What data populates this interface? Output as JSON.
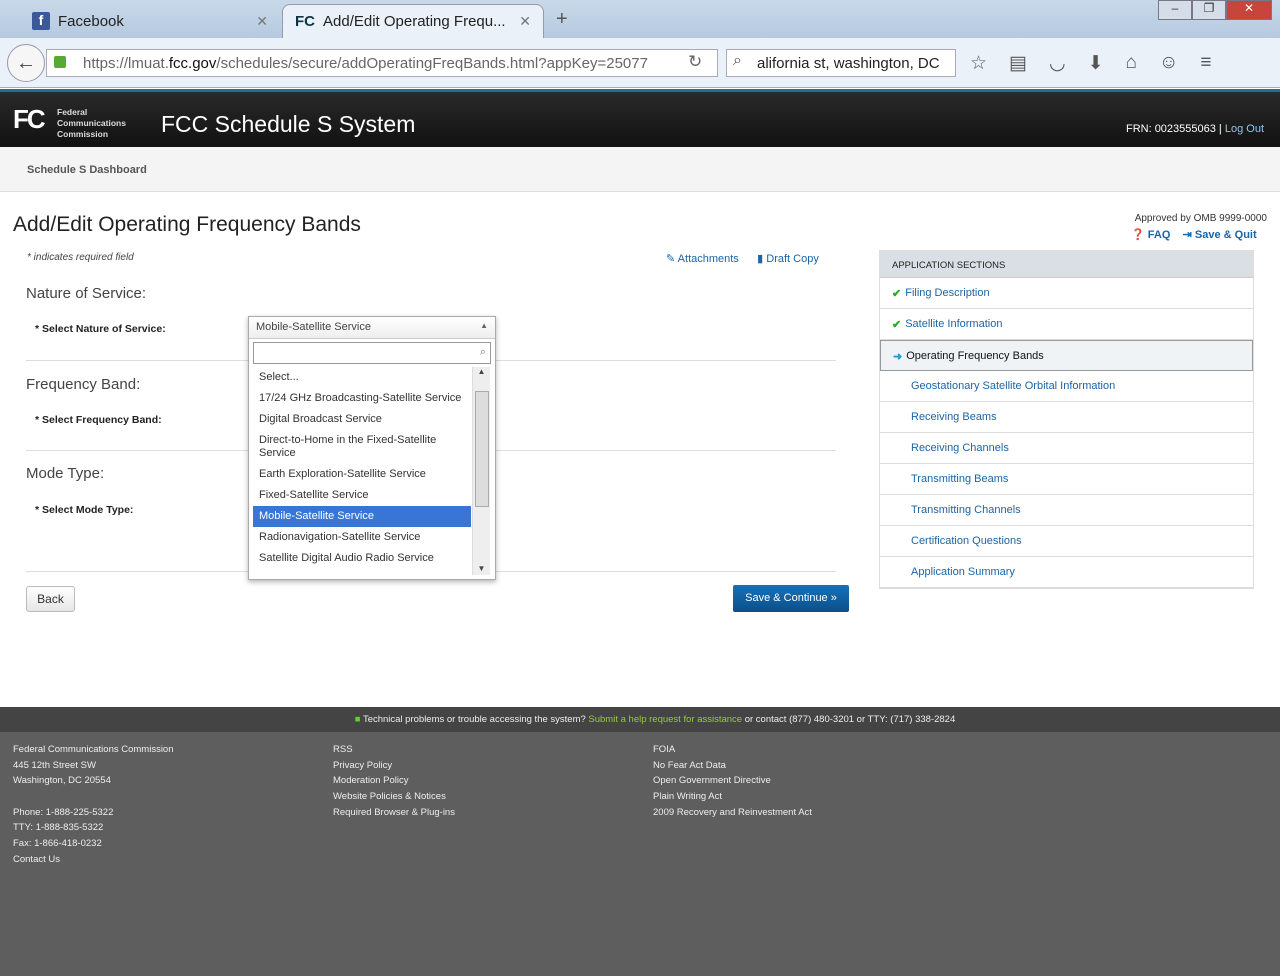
{
  "browser": {
    "tabs": [
      {
        "label": "Facebook",
        "icon": "facebook-icon"
      },
      {
        "label": "Add/Edit Operating Frequ...",
        "icon": "fcc-icon"
      }
    ],
    "url_prefix": "https://lmuat.",
    "url_domain": "fcc.gov",
    "url_rest": "/schedules/secure/addOperatingFreqBands.html?appKey=25077",
    "search_value": "alifornia st, washington, DC"
  },
  "header": {
    "logo": "FC",
    "logo_text": [
      "Federal",
      "Communications",
      "Commission"
    ],
    "title": "FCC Schedule S System",
    "frn": "FRN: 0023555063",
    "logout": "Log Out"
  },
  "subnav": {
    "dashboard": "Schedule S Dashboard"
  },
  "page": {
    "title": "Add/Edit Operating Frequency Bands",
    "omb": "Approved by OMB 9999-0000",
    "faq": "FAQ",
    "save_quit": "Save & Quit",
    "required_note": "* indicates required field",
    "attachments": "Attachments",
    "draft_copy": "Draft Copy"
  },
  "form": {
    "nature_heading": "Nature of Service:",
    "nature_label": "* Select Nature of Service:",
    "band_heading": "Frequency Band:",
    "band_label": "* Select Frequency Band:",
    "mode_heading": "Mode Type:",
    "mode_label": "* Select Mode Type:",
    "back": "Back",
    "save_continue": "Save & Continue »"
  },
  "dropdown": {
    "selected": "Mobile-Satellite Service",
    "search_value": "",
    "options": [
      "Select...",
      "17/24 GHz Broadcasting-Satellite Service",
      "Digital Broadcast Service",
      "Direct-to-Home in the Fixed-Satellite Service",
      "Earth Exploration-Satellite Service",
      "Fixed-Satellite Service",
      "Mobile-Satellite Service",
      "Radionavigation-Satellite Service",
      "Satellite Digital Audio Radio Service"
    ]
  },
  "sections": {
    "heading": "APPLICATION SECTIONS",
    "items": [
      {
        "label": "Filing Description",
        "state": "done"
      },
      {
        "label": "Satellite Information",
        "state": "done"
      },
      {
        "label": "Operating Frequency Bands",
        "state": "current"
      },
      {
        "label": "Geostationary Satellite Orbital Information"
      },
      {
        "label": "Receiving Beams"
      },
      {
        "label": "Receiving Channels"
      },
      {
        "label": "Transmitting Beams"
      },
      {
        "label": "Transmitting Channels"
      },
      {
        "label": "Certification Questions"
      },
      {
        "label": "Application Summary"
      }
    ]
  },
  "footer": {
    "help_pre": "Technical problems or trouble accessing the system?",
    "help_link": "Submit a help request for assistance",
    "help_post": "or contact (877) 480-3201 or TTY: (717) 338-2824",
    "col1": [
      "Federal Communications Commission",
      "445 12th Street SW",
      "Washington, DC 20554",
      "",
      "Phone: 1-888-225-5322",
      "TTY: 1-888-835-5322",
      "Fax: 1-866-418-0232",
      "Contact Us"
    ],
    "col2": [
      "RSS",
      "Privacy Policy",
      "Moderation Policy",
      "Website Policies & Notices",
      "Required Browser & Plug-ins"
    ],
    "col3": [
      "FOIA",
      "No Fear Act Data",
      "Open Government Directive",
      "Plain Writing Act",
      "2009 Recovery and Reinvestment Act"
    ]
  },
  "colors": {
    "link": "#1b64a6",
    "accent": "#0b4f8a",
    "highlight": "#3875d7"
  }
}
